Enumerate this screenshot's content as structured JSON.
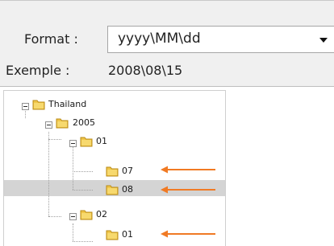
{
  "format": {
    "label": "Format :",
    "value": "yyyy\\MM\\dd"
  },
  "example": {
    "label": "Exemple :",
    "value": "2008\\08\\15"
  },
  "tree": {
    "items": [
      {
        "label": "Thailand",
        "level": 0,
        "expanded": true
      },
      {
        "label": "2005",
        "level": 1,
        "expanded": true
      },
      {
        "label": "01",
        "level": 2,
        "expanded": true
      },
      {
        "label": "07",
        "level": 3,
        "highlighted": true
      },
      {
        "label": "08",
        "level": 3,
        "selected": true,
        "highlighted": true
      },
      {
        "label": "02",
        "level": 2,
        "expanded": true
      },
      {
        "label": "01",
        "level": 3,
        "highlighted": true
      }
    ]
  },
  "colors": {
    "arrow": "#f07a24",
    "selection": "#d4d4d4",
    "folder": "#e8b830"
  },
  "icons": [
    "collapse-icon",
    "folder-icon",
    "orange-arrow-icon",
    "dropdown-arrow-icon"
  ]
}
